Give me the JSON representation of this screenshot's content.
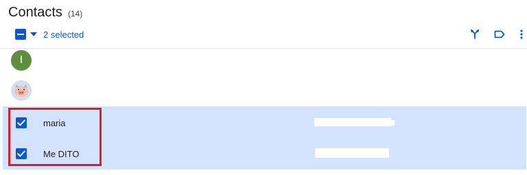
{
  "header": {
    "title": "Contacts",
    "count": "(14)"
  },
  "toolbar": {
    "selected_label": "2 selected",
    "icons": [
      "select-all-checkbox-indeterminate",
      "dropdown-caret-icon",
      "merge-icon",
      "label-icon",
      "more-vert-icon"
    ]
  },
  "contacts": [
    {
      "avatar_type": "letter",
      "avatar_letter": "I",
      "avatar_color": "#5e8e3e",
      "name": "",
      "selected": false
    },
    {
      "avatar_type": "image",
      "avatar_icon": "pig-face-icon",
      "name": "",
      "selected": false
    },
    {
      "name": "maria",
      "selected": true
    },
    {
      "name": "Me DITO",
      "selected": true
    }
  ],
  "colors": {
    "accent": "#0b57d0",
    "selected_row_bg": "#d3e3fd",
    "highlight_border": "#e01b24"
  }
}
